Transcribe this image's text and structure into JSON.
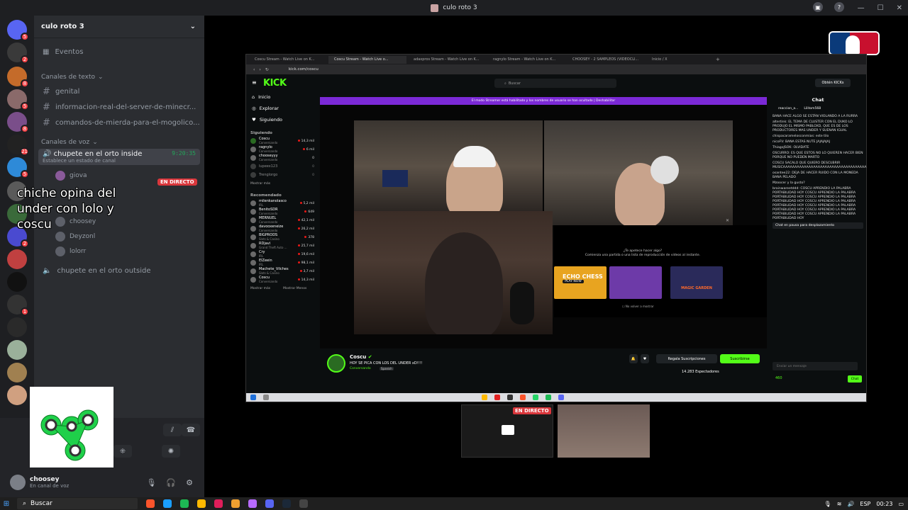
{
  "window": {
    "title": "culo roto 3",
    "controls": [
      "—",
      "☐",
      "✕"
    ]
  },
  "server": {
    "name": "culo roto 3",
    "text_category": "Canales de texto",
    "text_channels": [
      "genital",
      "informacion-real-del-server-de-minecr...",
      "comandos-de-mierda-para-el-mogolico..."
    ],
    "voice_category": "Canales de voz",
    "voice_channels": [
      {
        "name": "chupete en el orto inside",
        "time": "9:20:35",
        "status": "Establece un estado de canal"
      },
      {
        "name": "chupete en el orto outside"
      }
    ],
    "members": [
      "giova",
      "choosey",
      "Deyzonl",
      "lolorr"
    ],
    "live_label": "EN DIRECTO",
    "server_badges": [
      "5",
      "2",
      "8",
      "5",
      "8",
      "21",
      "5",
      "2",
      "1"
    ]
  },
  "overlay_text": "chiche opina del under con lolo y coscu",
  "user": {
    "name": "choosey",
    "status": "En canal de voz"
  },
  "browser": {
    "tabs": [
      "Coscu Stream - Watch Live on K...",
      "Coscu Stream - Watch Live o...",
      "adaxpros Stream - Watch Live on K...",
      "ragnylo Stream - Watch Live on K...",
      "CHOOSEY - 2 SAMPLEOS (VIDEOCLI...",
      "Inicio / X"
    ],
    "url": "kick.com/coscu"
  },
  "kick": {
    "logo": "KICK",
    "search_placeholder": "Buscar",
    "login_label": "Obtén KICKs",
    "nav": [
      "Inicio",
      "Explorar",
      "Siguiendo"
    ],
    "following_header": "Siguiendo",
    "following": [
      {
        "name": "Coscu",
        "sub": "Conversando",
        "count": "14,3 mil"
      },
      {
        "name": "ragnylo",
        "sub": "Conversando",
        "count": "6 mil"
      },
      {
        "name": "chooseyyy",
        "sub": "Conversando",
        "count": "0"
      },
      {
        "name": "lupeex123",
        "sub": "",
        "count": "0"
      },
      {
        "name": "Trenglorgo",
        "sub": "",
        "count": "0"
      }
    ],
    "show_more": "Mostrar más",
    "recommended_header": "Recomendado",
    "recommended": [
      {
        "name": "milenkanolasco",
        "sub": "IRL",
        "count": "5,2 mil"
      },
      {
        "name": "BenitoSDR",
        "sub": "Conversando",
        "count": "649"
      },
      {
        "name": "MERNUEL",
        "sub": "Conversando",
        "count": "42,1 mil"
      },
      {
        "name": "davooxeneize",
        "sub": "Conversando",
        "count": "26,2 mil"
      },
      {
        "name": "BIGPRODS",
        "sub": "Slots & Casino",
        "count": "378"
      },
      {
        "name": "RDjavi",
        "sub": "Grand Theft Auto ...",
        "count": "25,7 mil"
      },
      {
        "name": "Cry",
        "sub": "IRL",
        "count": "19,6 mil"
      },
      {
        "name": "ElZeein",
        "sub": "IRL",
        "count": "98,1 mil"
      },
      {
        "name": "Machete_Vilches",
        "sub": "Slots & Casino",
        "count": "3,7 mil"
      },
      {
        "name": "Coscu",
        "sub": "Conversando",
        "count": "14,3 mil"
      }
    ],
    "show_more_2": "Mostrar más",
    "show_less": "Mostrar Menos",
    "banner": "El modo Streamer está habilitado y los nombres de usuario se han ocultado | Deshabilitar",
    "ad_title": "¿Te apetece hacer algo?",
    "ad_subtitle": "Comienza una partida o una lista de reproducción de videos al instante.",
    "ad_games": [
      "ECHO CHESS",
      "",
      "MAGIC GARDEN"
    ],
    "ad_play": "PLAY NOW",
    "ad_checkbox": "No volver a mostrar",
    "stream": {
      "name": "Coscu",
      "title": "HOY SE PICA CON LOS DEL UNDER xD!!!!",
      "category": "Conversando",
      "language": "Spanish",
      "viewers": "14.283 Espectadores",
      "gift_label": "Regala Suscripciones",
      "subscribe_label": "Suscribirse"
    },
    "chat": {
      "title": "Chat",
      "top_users": [
        "reaccion_a...",
        "Lilitom568",
        "coldantu..."
      ],
      "messages": [
        "BANA HACE ALGO SE ESTÁN VIOLANDO A LA RURRA",
        "altertink: EL TEMA DE CLUSTER CON EL DUKO LO PRODUJO EL MISMO PABLOXD, QUE ES DE LOS PRODUCTORES MAS UNDER Y SUENAN IGUAL",
        "chispacaramelosconmias: este tilo",
        "nicoFV: BANA ESTAS NUTE JAJAJAJAJ",
        "ThiagoJSOK: OLVIDATE",
        "OSCURRO: ES QUE ESTOS NO LO QUIEREN HACER BIEN PORQUE NO PUEDEN MARTO",
        "COSCU SACALO QUE QUIERO DESCUBRIR MUSICAAAAAAAAAAAAAAAAAAAAAAAAAAAAAAAAAAAA",
        "osantee22: DEJA DE HACER RUIDO CON LA MONEDA BANA PELADO",
        "Mzoocer y la gusto?",
        "brainwareetddd: COSCU APRENDIO LA PALABRA PORTABILIDAD HOY COSCU APRENDIO LA PALABRA PORTABILIDAD HOY COSCU APRENDIO LA PALABRA PORTABILIDAD HOY COSCU APRENDIO LA PALABRA PORTABILIDAD HOY COSCU APRENDIO LA PALABRA PORTABILIDAD HOY COSCU APRENDIO LA PALABRA PORTABILIDAD HOY COSCU APRENDIO LA PALABRA PORTABILIDAD HOY"
      ],
      "paused": "Chat en pausa para desplazamiento",
      "input_placeholder": "Enviar un mensaje",
      "points": "460",
      "send_label": "Chat"
    }
  },
  "preview": {
    "live_label": "EN DIRECTO"
  },
  "taskbar": {
    "search_label": "Buscar",
    "lang": "ESP",
    "time": "00:23"
  },
  "colors": {
    "kick_green": "#53fc18",
    "discord_live": "#da373c",
    "banner_purple": "#7b29d6"
  }
}
